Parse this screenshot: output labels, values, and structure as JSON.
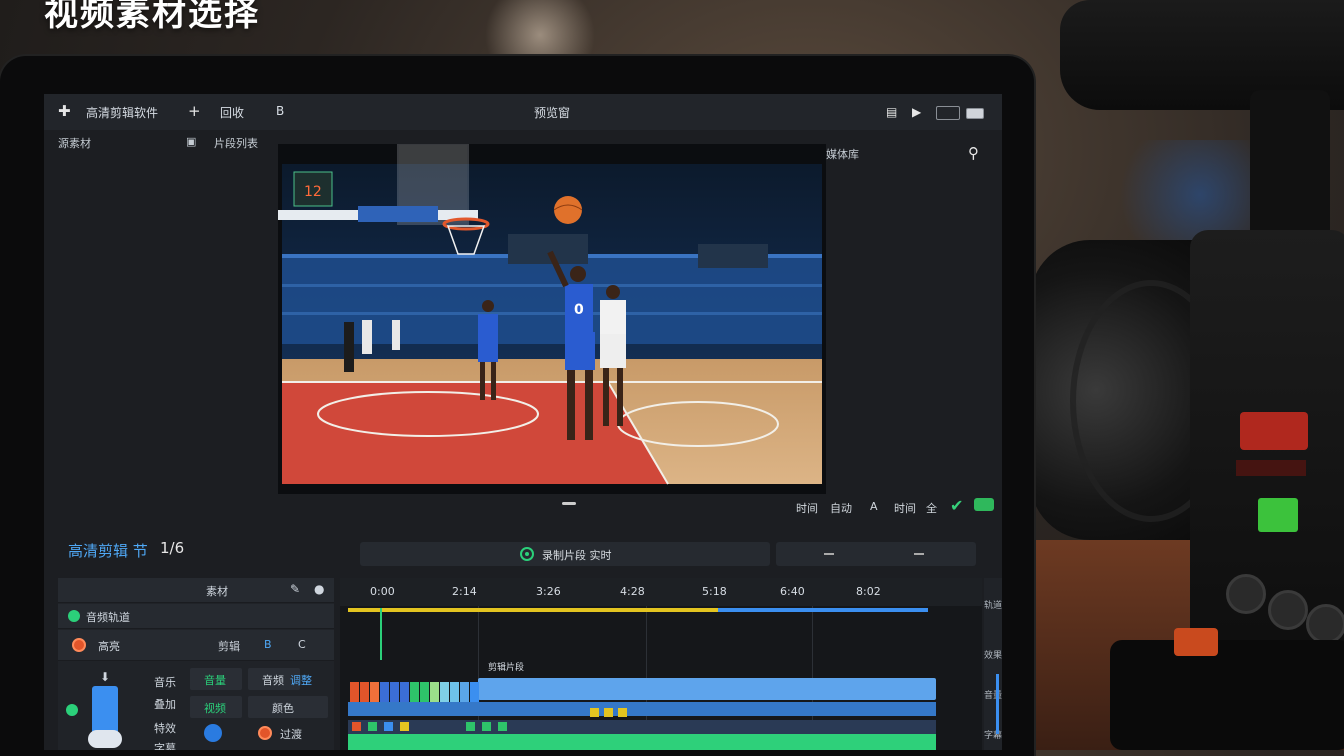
{
  "overlay_title": "视频素材选择",
  "colors": {
    "accent": "#3b8ff0",
    "record": "#2bd07a",
    "clip_yellow": "#e3c420",
    "clip_green": "#2ed07a"
  },
  "topbar": {
    "app_name": "高清剪辑软件",
    "add_label": "+",
    "menu1": "回收",
    "menu2": "B",
    "title": "预览窗",
    "right_icons": [
      "list-icon",
      "play-icon",
      "window-icon",
      "window-max-icon"
    ]
  },
  "subbar": {
    "left": "源素材",
    "mid": "片段列表"
  },
  "right_panel_label": "媒体库",
  "preview_bar": {
    "items": [
      "时间",
      "自动",
      "A",
      "时间",
      "全",
      "V"
    ]
  },
  "midbar": {
    "left_label": "高清剪辑 节",
    "left_value": "1/6",
    "center_label": "录制片段 实时",
    "right": "——"
  },
  "left_panel": {
    "row1": "素材",
    "row2": "音频轨道",
    "row3": "高亮",
    "row3_icons": [
      "剪辑",
      "B",
      "C"
    ],
    "grid": [
      "音乐",
      "叠加",
      "特效",
      "音量",
      "音频",
      "调整",
      "视频",
      "颜色",
      "过渡",
      "字幕"
    ]
  },
  "timeline": {
    "ruler": [
      "0:00",
      "2:14",
      "3:26",
      "4:28",
      "5:18",
      "6:40",
      "8:02"
    ],
    "note": "剪辑片段"
  },
  "right_side": [
    "轨道",
    "效果",
    "音量",
    "字幕"
  ],
  "scene": {
    "jersey_number": "0",
    "scoreboard": "12"
  }
}
